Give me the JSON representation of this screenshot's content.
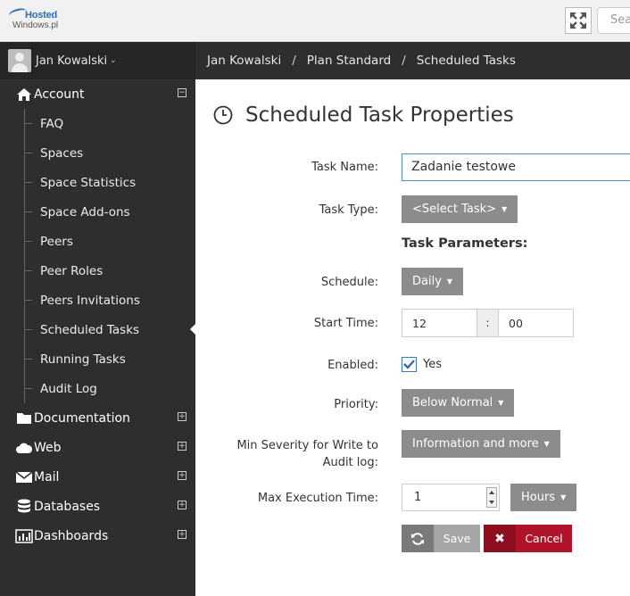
{
  "logo": {
    "line1": "Hosted",
    "line2": "Windows.pl"
  },
  "search": {
    "placeholder": "Search"
  },
  "user": {
    "name": "Jan Kowalski"
  },
  "breadcrumb": [
    "Jan Kowalski",
    "Plan Standard",
    "Scheduled Tasks"
  ],
  "sidebar": {
    "account": "Account",
    "account_items": [
      "FAQ",
      "Spaces",
      "Space Statistics",
      "Space Add-ons",
      "Peers",
      "Peer Roles",
      "Peers Invitations",
      "Scheduled Tasks",
      "Running Tasks",
      "Audit Log"
    ],
    "active_item": "Scheduled Tasks",
    "sections": [
      "Documentation",
      "Web",
      "Mail",
      "Databases",
      "Dashboards"
    ]
  },
  "page": {
    "title": "Scheduled Task Properties"
  },
  "form": {
    "task_name_label": "Task Name:",
    "task_name_value": "Zadanie testowe",
    "task_type_label": "Task Type:",
    "task_type_value": "<Select Task>",
    "params_heading": "Task Parameters:",
    "schedule_label": "Schedule:",
    "schedule_value": "Daily",
    "start_time_label": "Start Time:",
    "start_hour": "12",
    "time_separator": ":",
    "start_minute": "00",
    "enabled_label": "Enabled:",
    "enabled_text": "Yes",
    "priority_label": "Priority:",
    "priority_value": "Below Normal",
    "severity_label": "Min Severity for Write to Audit log:",
    "severity_value": "Information and more",
    "max_exec_label": "Max Execution Time:",
    "max_exec_value": "1",
    "max_exec_unit": "Hours",
    "save_label": "Save",
    "cancel_label": "Cancel"
  },
  "colors": {
    "sidebar_bg": "#2e2e2e",
    "cancel": "#b0132a",
    "grey_button": "#8c8c8c",
    "focus_border": "#4a90c8"
  }
}
